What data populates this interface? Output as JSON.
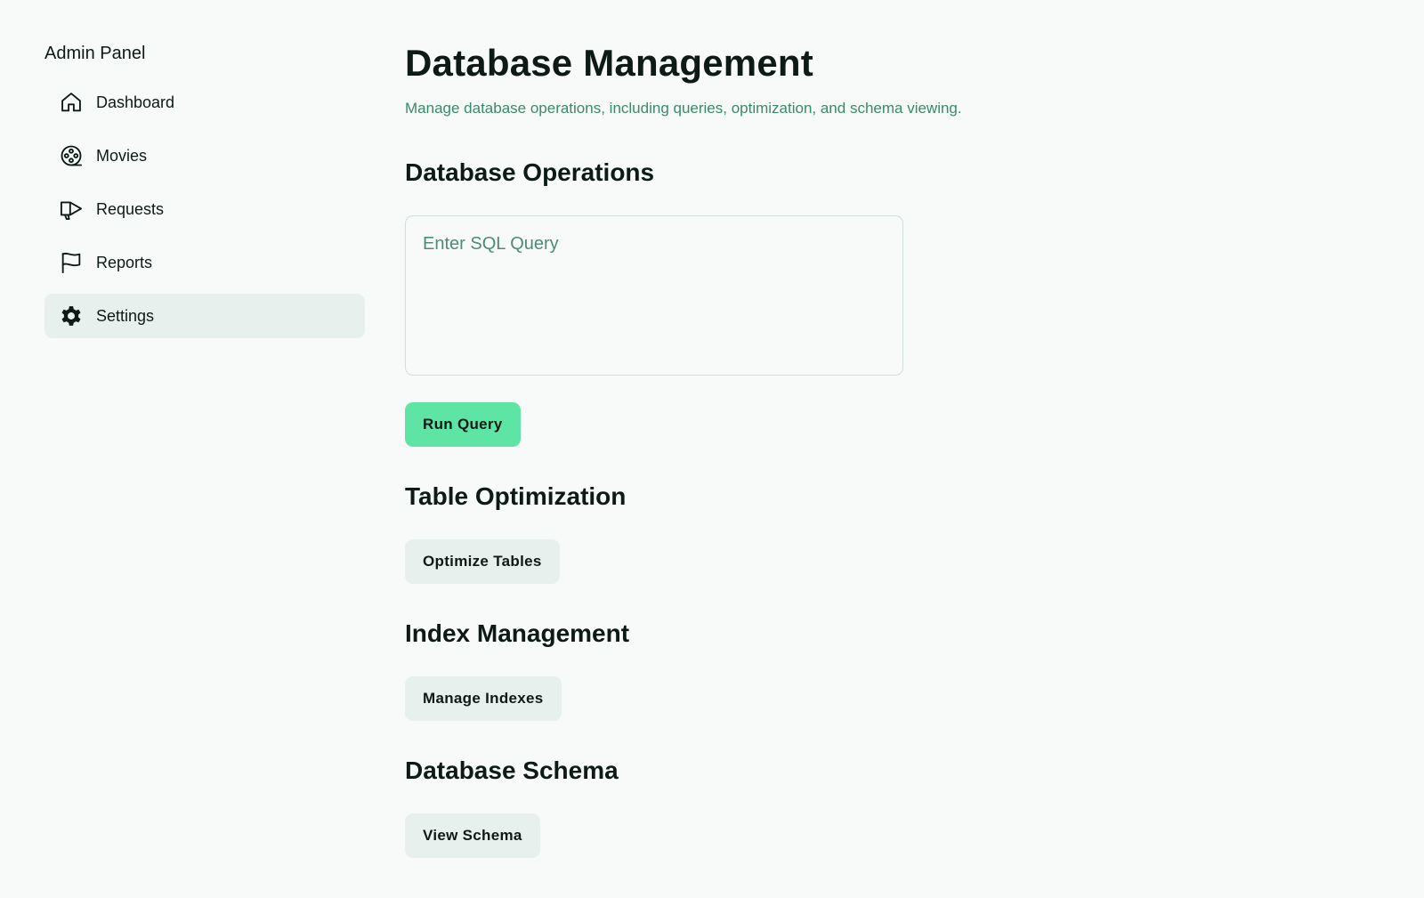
{
  "sidebar": {
    "title": "Admin Panel",
    "items": [
      {
        "label": "Dashboard",
        "icon": "home-icon"
      },
      {
        "label": "Movies",
        "icon": "film-reel-icon"
      },
      {
        "label": "Requests",
        "icon": "megaphone-icon"
      },
      {
        "label": "Reports",
        "icon": "flag-icon"
      },
      {
        "label": "Settings",
        "icon": "gear-icon",
        "active": true
      }
    ]
  },
  "main": {
    "title": "Database Management",
    "subtitle": "Manage database operations, including queries, optimization, and schema viewing.",
    "operations": {
      "heading": "Database Operations",
      "query_placeholder": "Enter SQL Query",
      "query_value": "",
      "run_label": "Run Query"
    },
    "optimization": {
      "heading": "Table Optimization",
      "button_label": "Optimize Tables"
    },
    "indexes": {
      "heading": "Index Management",
      "button_label": "Manage Indexes"
    },
    "schema": {
      "heading": "Database Schema",
      "button_label": "View Schema"
    }
  },
  "colors": {
    "background": "#f7faf9",
    "accent": "#5ee4a4",
    "secondary_button": "#e8f0ed",
    "subtitle": "#3a8a6a",
    "text": "#0e1a16"
  }
}
